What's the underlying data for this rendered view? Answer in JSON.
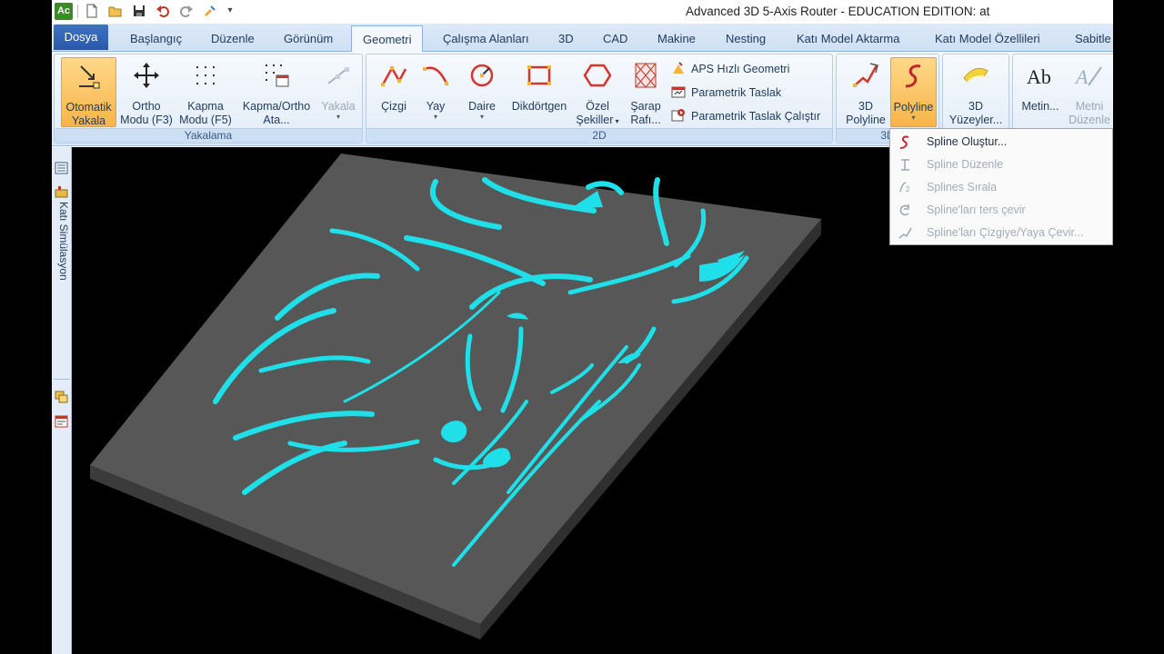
{
  "app": {
    "logo_text": "Ac",
    "window_title": "Advanced 3D 5-Axis Router - EDUCATION EDITION: at"
  },
  "quick_access": {
    "new": "new-file-icon",
    "open": "open-folder-icon",
    "save": "save-icon",
    "undo": "undo-icon",
    "redo": "redo-icon",
    "paste": "paste-icon",
    "more": "▾"
  },
  "tabs": {
    "file": "Dosya",
    "items": [
      "Başlangıç",
      "Düzenle",
      "Görünüm",
      "Geometri",
      "Çalışma Alanları",
      "3D",
      "CAD",
      "Makine",
      "Nesting",
      "Katı Model Aktarma",
      "Katı Model Özellileri",
      "Sabitle"
    ],
    "active": "Geometri"
  },
  "ribbon": {
    "yakalama": {
      "caption": "Yakalama",
      "buttons": [
        {
          "l1": "Otomatik",
          "l2": "Yakala",
          "icon": "auto-snap-icon",
          "state": "active"
        },
        {
          "l1": "Ortho",
          "l2": "Modu (F3)",
          "icon": "ortho-move-icon",
          "state": "normal"
        },
        {
          "l1": "Kapma",
          "l2": "Modu (F5)",
          "icon": "snap-grid-icon",
          "state": "normal"
        },
        {
          "l1": "Kapma/Ortho",
          "l2": "Ata...",
          "icon": "snap-ortho-settings-icon",
          "state": "normal"
        },
        {
          "l1": "Yakala",
          "l2": "",
          "icon": "snap-disabled-icon",
          "state": "disabled"
        }
      ]
    },
    "twod": {
      "caption": "2D",
      "buttons": [
        {
          "l1": "Çizgi",
          "l2": "",
          "icon": "line-icon"
        },
        {
          "l1": "Yay",
          "l2": "",
          "icon": "arc-icon"
        },
        {
          "l1": "Daire",
          "l2": "",
          "icon": "circle-icon"
        },
        {
          "l1": "Dikdörtgen",
          "l2": "",
          "icon": "rectangle-icon"
        },
        {
          "l1": "Özel",
          "l2": "Şekiller",
          "icon": "hexagon-icon"
        },
        {
          "l1": "Şarap",
          "l2": "Rafı...",
          "icon": "wine-rack-icon"
        }
      ],
      "small": [
        "APS Hızlı Geometri",
        "Parametrik Taslak",
        "Parametrik Taslak Çalıştır"
      ]
    },
    "threed": {
      "caption": "3D",
      "buttons": [
        {
          "l1": "3D",
          "l2": "Polyline",
          "icon": "3d-polyline-icon",
          "state": "normal"
        },
        {
          "l1": "Polyline",
          "l2": "",
          "icon": "polyline-icon",
          "state": "hot"
        }
      ]
    },
    "surfaces": {
      "buttons": [
        {
          "l1": "3D",
          "l2": "Yüzeyler..."
        }
      ]
    },
    "text": {
      "buttons": [
        {
          "l1": "Metin...",
          "l2": "",
          "state": "normal"
        },
        {
          "l1": "Metni",
          "l2": "Düzenle",
          "state": "disabled"
        }
      ]
    }
  },
  "left_panel": {
    "label": "Katı Simülasyon"
  },
  "dropdown": {
    "items": [
      {
        "label": "Spline Oluştur...",
        "icon": "spline-create-icon",
        "enabled": true
      },
      {
        "label": "Spline Düzenle",
        "icon": "spline-edit-icon",
        "enabled": false
      },
      {
        "label": "Splines Sırala",
        "icon": "spline-sort-icon",
        "enabled": false
      },
      {
        "label": "Spline'ları ters çevir",
        "icon": "spline-reverse-icon",
        "enabled": false
      },
      {
        "label": "Spline'ları Çizgiye/Yaya Çevir...",
        "icon": "spline-convert-icon",
        "enabled": false
      }
    ]
  },
  "colors": {
    "background_3d": "#000000",
    "plate": "#575757",
    "carving": "#1fe0e8",
    "ribbon_accent": "#f9b449",
    "file_tab": "#2a58a8"
  }
}
